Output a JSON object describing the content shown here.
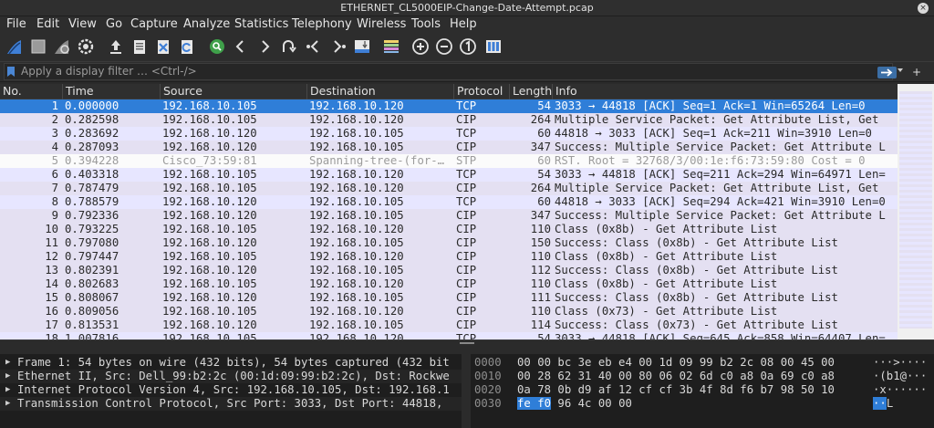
{
  "window": {
    "title": "ETHERNET_CL5000EIP-Change-Date-Attempt.pcap",
    "close_glyph": "×"
  },
  "menu": [
    "File",
    "Edit",
    "View",
    "Go",
    "Capture",
    "Analyze",
    "Statistics",
    "Telephony",
    "Wireless",
    "Tools",
    "Help"
  ],
  "toolbar_icons": [
    "shark-fin-icon",
    "stop-icon",
    "restart-icon",
    "options-gear-icon",
    "open-file-icon",
    "save-file-icon",
    "close-file-icon",
    "reload-icon",
    "find-icon",
    "back-icon",
    "forward-icon",
    "go-to-packet-icon",
    "first-packet-icon",
    "last-packet-icon",
    "autoscroll-icon",
    "colorize-icon",
    "zoom-in-icon",
    "zoom-out-icon",
    "normal-size-icon",
    "resize-columns-icon"
  ],
  "filter": {
    "placeholder": "Apply a display filter … <Ctrl-/>",
    "add_label": "+"
  },
  "columns": [
    "No.",
    "Time",
    "Source",
    "Destination",
    "Protocol",
    "Length",
    "Info"
  ],
  "packets": [
    {
      "no": "1",
      "time": "0.000000",
      "src": "192.168.10.105",
      "dst": "192.168.10.120",
      "proto": "TCP",
      "len": "54",
      "info": "3033 → 44818 [ACK] Seq=1 Ack=1 Win=65264 Len=0",
      "kind": "sel"
    },
    {
      "no": "2",
      "time": "0.282598",
      "src": "192.168.10.105",
      "dst": "192.168.10.120",
      "proto": "CIP",
      "len": "264",
      "info": "Multiple Service Packet: Get Attribute List, Get",
      "kind": "cip"
    },
    {
      "no": "3",
      "time": "0.283692",
      "src": "192.168.10.120",
      "dst": "192.168.10.105",
      "proto": "TCP",
      "len": "60",
      "info": "44818 → 3033 [ACK] Seq=1 Ack=211 Win=3910 Len=0",
      "kind": "tcp"
    },
    {
      "no": "4",
      "time": "0.287093",
      "src": "192.168.10.120",
      "dst": "192.168.10.105",
      "proto": "CIP",
      "len": "347",
      "info": "Success: Multiple Service Packet: Get Attribute L",
      "kind": "cip"
    },
    {
      "no": "5",
      "time": "0.394228",
      "src": "Cisco_73:59:81",
      "dst": "Spanning-tree-(for-…",
      "proto": "STP",
      "len": "60",
      "info": "RST. Root = 32768/3/00:1e:f6:73:59:80  Cost = 0",
      "kind": "stp"
    },
    {
      "no": "6",
      "time": "0.403318",
      "src": "192.168.10.105",
      "dst": "192.168.10.120",
      "proto": "TCP",
      "len": "54",
      "info": "3033 → 44818 [ACK] Seq=211 Ack=294 Win=64971 Len=",
      "kind": "tcp"
    },
    {
      "no": "7",
      "time": "0.787479",
      "src": "192.168.10.105",
      "dst": "192.168.10.120",
      "proto": "CIP",
      "len": "264",
      "info": "Multiple Service Packet: Get Attribute List, Get",
      "kind": "cip"
    },
    {
      "no": "8",
      "time": "0.788579",
      "src": "192.168.10.120",
      "dst": "192.168.10.105",
      "proto": "TCP",
      "len": "60",
      "info": "44818 → 3033 [ACK] Seq=294 Ack=421 Win=3910 Len=0",
      "kind": "tcp"
    },
    {
      "no": "9",
      "time": "0.792336",
      "src": "192.168.10.120",
      "dst": "192.168.10.105",
      "proto": "CIP",
      "len": "347",
      "info": "Success: Multiple Service Packet: Get Attribute L",
      "kind": "cip"
    },
    {
      "no": "10",
      "time": "0.793225",
      "src": "192.168.10.105",
      "dst": "192.168.10.120",
      "proto": "CIP",
      "len": "110",
      "info": "Class (0x8b) - Get Attribute List",
      "kind": "cip"
    },
    {
      "no": "11",
      "time": "0.797080",
      "src": "192.168.10.120",
      "dst": "192.168.10.105",
      "proto": "CIP",
      "len": "150",
      "info": "Success: Class (0x8b) - Get Attribute List",
      "kind": "cip"
    },
    {
      "no": "12",
      "time": "0.797447",
      "src": "192.168.10.105",
      "dst": "192.168.10.120",
      "proto": "CIP",
      "len": "110",
      "info": "Class (0x8b) - Get Attribute List",
      "kind": "cip"
    },
    {
      "no": "13",
      "time": "0.802391",
      "src": "192.168.10.120",
      "dst": "192.168.10.105",
      "proto": "CIP",
      "len": "112",
      "info": "Success: Class (0x8b) - Get Attribute List",
      "kind": "cip"
    },
    {
      "no": "14",
      "time": "0.802683",
      "src": "192.168.10.105",
      "dst": "192.168.10.120",
      "proto": "CIP",
      "len": "110",
      "info": "Class (0x8b) - Get Attribute List",
      "kind": "cip"
    },
    {
      "no": "15",
      "time": "0.808067",
      "src": "192.168.10.120",
      "dst": "192.168.10.105",
      "proto": "CIP",
      "len": "111",
      "info": "Success: Class (0x8b) - Get Attribute List",
      "kind": "cip"
    },
    {
      "no": "16",
      "time": "0.809056",
      "src": "192.168.10.105",
      "dst": "192.168.10.120",
      "proto": "CIP",
      "len": "110",
      "info": "Class (0x73) - Get Attribute List",
      "kind": "cip"
    },
    {
      "no": "17",
      "time": "0.813531",
      "src": "192.168.10.120",
      "dst": "192.168.10.105",
      "proto": "CIP",
      "len": "114",
      "info": "Success: Class (0x73) - Get Attribute List",
      "kind": "cip"
    },
    {
      "no": "18",
      "time": "1.007816",
      "src": "192.168.10.105",
      "dst": "192.168.10.120",
      "proto": "TCP",
      "len": "54",
      "info": "3033 → 44818 [ACK] Seq=645 Ack=858 Win=64407 Len=",
      "kind": "tcp"
    }
  ],
  "details": [
    "Frame 1: 54 bytes on wire (432 bits), 54 bytes captured (432 bit",
    "Ethernet II, Src: Dell_99:b2:2c (00:1d:09:99:b2:2c), Dst: Rockwe",
    "Internet Protocol Version 4, Src: 192.168.10.105, Dst: 192.168.1",
    "Transmission Control Protocol, Src Port: 3033, Dst Port: 44818,"
  ],
  "hex": [
    {
      "offset": "0000",
      "bytes": "00 00 bc 3e eb e4 00 1d  09 99 b2 2c 08 00 45 00",
      "ascii": "···>····",
      "hl_bytes": "",
      "hl_ascii": ""
    },
    {
      "offset": "0010",
      "bytes": "00 28 62 31 40 00 80 06  02 6d c0 a8 0a 69 c0 a8",
      "ascii": "·(b1@···",
      "hl_bytes": "",
      "hl_ascii": ""
    },
    {
      "offset": "0020",
      "bytes": "0a 78 0b d9 af 12 cf cf  3b 4f 8d f6 b7 98 50 10",
      "ascii": "·x······",
      "hl_bytes": "",
      "hl_ascii": ""
    },
    {
      "offset": "0030",
      "bytes": " 96 4c 00 00",
      "ascii": "L",
      "hl_bytes": "fe f0",
      "hl_ascii": "··"
    }
  ]
}
